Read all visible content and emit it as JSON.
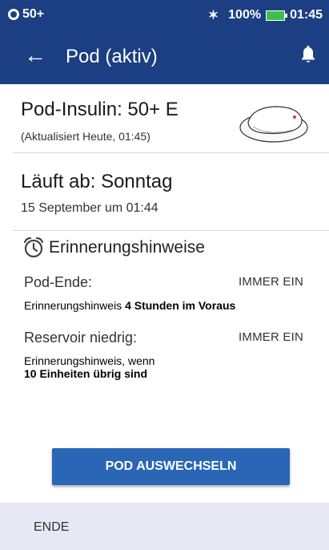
{
  "status_bar": {
    "left_text": "50+",
    "battery_percent": "100%",
    "time": "01:45"
  },
  "app_bar": {
    "title": "Pod (aktiv)"
  },
  "insulin": {
    "title": "Pod-Insulin: 50+ E",
    "updated": "(Aktualisiert Heute, 01:45)"
  },
  "expires": {
    "title": "Läuft ab: Sonntag",
    "date": "15 September um 01:44"
  },
  "reminders": {
    "title": "Erinnerungshinweise",
    "items": [
      {
        "label": "Pod-Ende:",
        "state": "IMMER EIN",
        "desc_prefix": "Erinnerungshinweis ",
        "desc_bold": "4 Stunden im Voraus"
      },
      {
        "label": "Reservoir niedrig:",
        "state": "IMMER EIN",
        "desc_prefix": "Erinnerungshinweis, wenn",
        "desc_bold": "10 Einheiten übrig sind"
      }
    ]
  },
  "actions": {
    "replace_pod": "POD AUSWECHSELN",
    "end": "ENDE"
  },
  "colors": {
    "header": "#1b3f82",
    "button": "#2a65b6",
    "footer": "#e6e9f3"
  }
}
